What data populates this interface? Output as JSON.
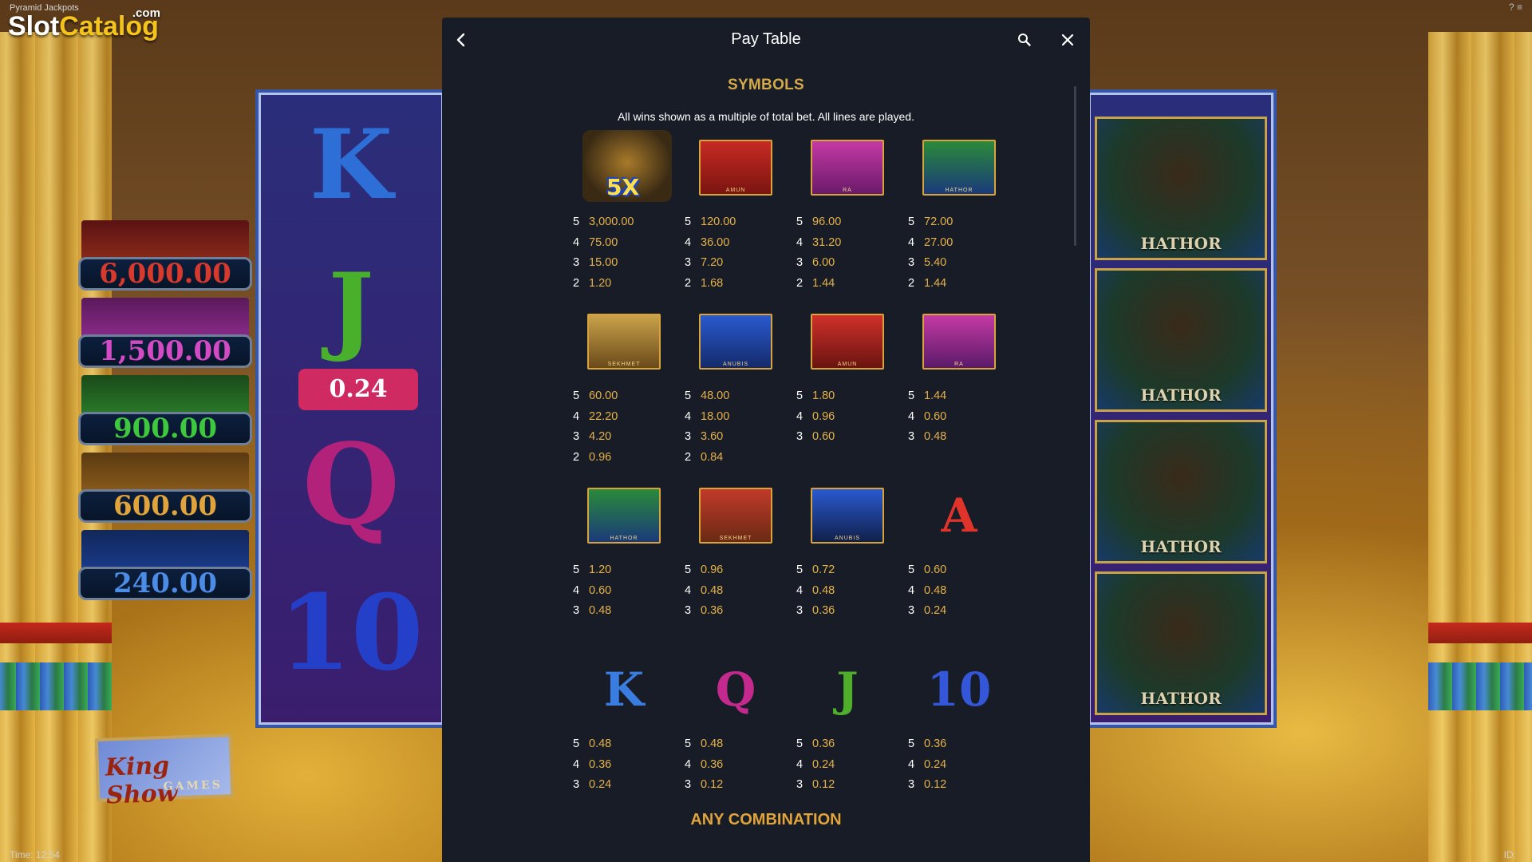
{
  "app": {
    "game_name": "Pyramid Jackpots",
    "logo": {
      "slot": "Slot",
      "catalog": "Catalog",
      "dotcom": ".com"
    },
    "time": "Time: 12:54",
    "id_label": "ID:",
    "top_icons": "? ≡"
  },
  "background": {
    "reel_left": {
      "letters": [
        "K",
        "J",
        "Q",
        "10"
      ],
      "win_value": "0.24"
    },
    "jackpots": [
      {
        "value": "6,000.00",
        "color": "#d7392d"
      },
      {
        "value": "1,500.00",
        "color": "#d34bc4"
      },
      {
        "value": "900.00",
        "color": "#3ec83e"
      },
      {
        "value": "600.00",
        "color": "#e0a43a"
      },
      {
        "value": "240.00",
        "color": "#4b8de6"
      }
    ],
    "reel_right_labels": [
      "HATHOR",
      "HATHOR",
      "HATHOR",
      "HATHOR"
    ],
    "brand": {
      "title": "King Show",
      "sub": "GAMES"
    }
  },
  "modal": {
    "title": "Pay Table",
    "back_icon": "chevron-left-icon",
    "search_icon": "search-icon",
    "close_icon": "close-icon",
    "section_symbols": "SYMBOLS",
    "subtitle": "All wins shown as a multiple of total bet. All lines are played.",
    "section_any": "ANY COMBINATION",
    "rows": [
      [
        {
          "name": "wild-5x",
          "label": "5X",
          "pays": [
            [
              "5",
              "3,000.00"
            ],
            [
              "4",
              "75.00"
            ],
            [
              "3",
              "15.00"
            ],
            [
              "2",
              "1.20"
            ]
          ]
        },
        {
          "name": "amun-pair",
          "label": "AMUN",
          "pays": [
            [
              "5",
              "120.00"
            ],
            [
              "4",
              "36.00"
            ],
            [
              "3",
              "7.20"
            ],
            [
              "2",
              "1.68"
            ]
          ]
        },
        {
          "name": "ra-pair",
          "label": "RA",
          "pays": [
            [
              "5",
              "96.00"
            ],
            [
              "4",
              "31.20"
            ],
            [
              "3",
              "6.00"
            ],
            [
              "2",
              "1.44"
            ]
          ]
        },
        {
          "name": "hathor-pair",
          "label": "HATHOR",
          "pays": [
            [
              "5",
              "72.00"
            ],
            [
              "4",
              "27.00"
            ],
            [
              "3",
              "5.40"
            ],
            [
              "2",
              "1.44"
            ]
          ]
        }
      ],
      [
        {
          "name": "sekhmet-pair",
          "label": "SEKHMET",
          "pays": [
            [
              "5",
              "60.00"
            ],
            [
              "4",
              "22.20"
            ],
            [
              "3",
              "4.20"
            ],
            [
              "2",
              "0.96"
            ]
          ]
        },
        {
          "name": "anubis-pair",
          "label": "ANUBIS",
          "pays": [
            [
              "5",
              "48.00"
            ],
            [
              "4",
              "18.00"
            ],
            [
              "3",
              "3.60"
            ],
            [
              "2",
              "0.84"
            ]
          ]
        },
        {
          "name": "amun",
          "label": "AMUN",
          "pays": [
            [
              "5",
              "1.80"
            ],
            [
              "4",
              "0.96"
            ],
            [
              "3",
              "0.60"
            ]
          ]
        },
        {
          "name": "ra",
          "label": "RA",
          "pays": [
            [
              "5",
              "1.44"
            ],
            [
              "4",
              "0.60"
            ],
            [
              "3",
              "0.48"
            ]
          ]
        }
      ],
      [
        {
          "name": "hathor",
          "label": "HATHOR",
          "pays": [
            [
              "5",
              "1.20"
            ],
            [
              "4",
              "0.60"
            ],
            [
              "3",
              "0.48"
            ]
          ]
        },
        {
          "name": "sekhmet",
          "label": "SEKHMET",
          "pays": [
            [
              "5",
              "0.96"
            ],
            [
              "4",
              "0.48"
            ],
            [
              "3",
              "0.36"
            ]
          ]
        },
        {
          "name": "anubis",
          "label": "ANUBIS",
          "pays": [
            [
              "5",
              "0.72"
            ],
            [
              "4",
              "0.48"
            ],
            [
              "3",
              "0.36"
            ]
          ]
        },
        {
          "name": "letter-a",
          "glyph": "A",
          "pays": [
            [
              "5",
              "0.60"
            ],
            [
              "4",
              "0.48"
            ],
            [
              "3",
              "0.24"
            ]
          ]
        }
      ],
      [
        {
          "name": "letter-k",
          "glyph": "K",
          "pays": [
            [
              "5",
              "0.48"
            ],
            [
              "4",
              "0.36"
            ],
            [
              "3",
              "0.24"
            ]
          ]
        },
        {
          "name": "letter-q",
          "glyph": "Q",
          "pays": [
            [
              "5",
              "0.48"
            ],
            [
              "4",
              "0.36"
            ],
            [
              "3",
              "0.12"
            ]
          ]
        },
        {
          "name": "letter-j",
          "glyph": "J",
          "pays": [
            [
              "5",
              "0.36"
            ],
            [
              "4",
              "0.24"
            ],
            [
              "3",
              "0.12"
            ]
          ]
        },
        {
          "name": "letter-10",
          "glyph": "10",
          "pays": [
            [
              "5",
              "0.36"
            ],
            [
              "4",
              "0.24"
            ],
            [
              "3",
              "0.12"
            ]
          ]
        }
      ]
    ]
  },
  "colors": {
    "panel": "#181c26",
    "gold": "#d4a94a",
    "amount": "#e5b24a",
    "glyph_a": "#e0332a",
    "glyph_k": "#3a7de0",
    "glyph_q": "#c42a8e",
    "glyph_j": "#4fae2a",
    "glyph_10": "#3456d8"
  }
}
